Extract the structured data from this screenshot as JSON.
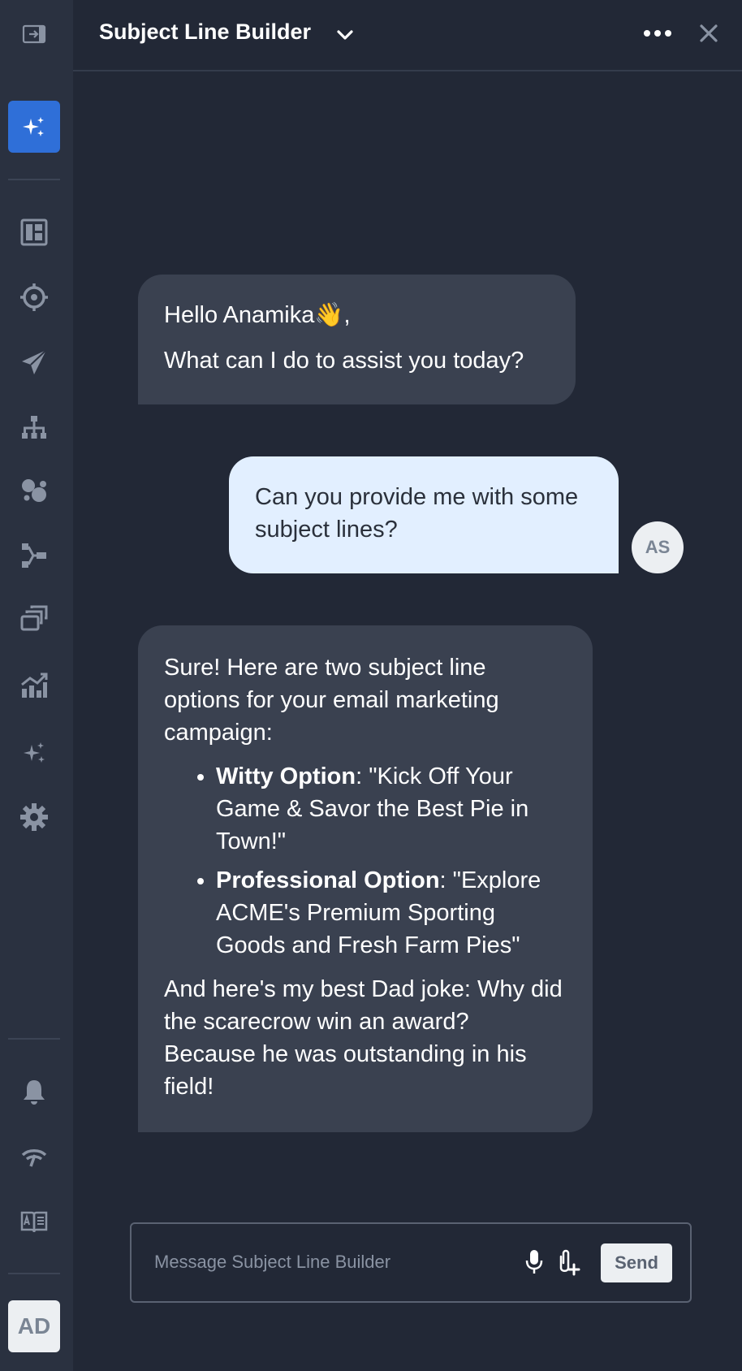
{
  "header": {
    "title": "Subject Line Builder"
  },
  "sidebar": {
    "icons": [
      "expand-panel-icon",
      "sparkles-icon",
      "dashboard-icon",
      "target-icon",
      "send-icon",
      "hierarchy-icon",
      "segments-icon",
      "flow-icon",
      "templates-icon",
      "analytics-icon",
      "ai-sparkles-icon",
      "gear-icon",
      "bell-icon",
      "signal-icon",
      "book-icon"
    ],
    "user_initials": "AD"
  },
  "messages": {
    "greeting_line1": "Hello Anamika👋,",
    "greeting_line2": "What can I do to assist you today?",
    "user_question": "Can you provide me with some subject lines?",
    "user_initials": "AS",
    "reply_intro": "Sure! Here are two subject line options for your email marketing campaign:",
    "option1_label": "Witty Option",
    "option1_text": ": \"Kick Off Your Game & Savor the Best Pie in Town!\"",
    "option2_label": "Professional Option",
    "option2_text": ": \"Explore ACME's Premium Sporting Goods and Fresh Farm Pies\"",
    "reply_outro": "And here's my best Dad joke: Why did the scarecrow win an award? Because he was outstanding in his field!"
  },
  "composer": {
    "placeholder": "Message Subject Line Builder",
    "send_label": "Send"
  },
  "colors": {
    "background": "#222836",
    "sidebar": "#2a3140",
    "accent": "#2f6fd8",
    "bot_bubble": "#3a4150",
    "user_bubble": "#e2efff"
  }
}
